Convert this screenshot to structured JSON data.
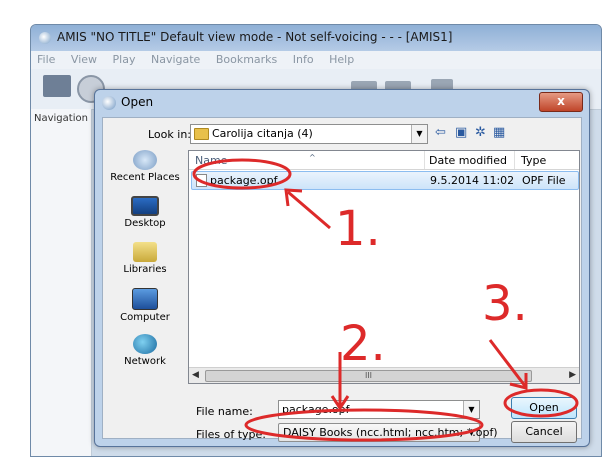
{
  "app": {
    "title": "AMIS \"NO TITLE\" Default view mode - Not self-voicing - - - [AMIS1]",
    "menu": [
      "File",
      "View",
      "Play",
      "Navigate",
      "Bookmarks",
      "Info",
      "Help"
    ],
    "nav_label": "Navigation"
  },
  "dialog": {
    "title": "Open",
    "close_label": "x",
    "look_in_label": "Look in:",
    "look_in_value": "Carolija citanja (4)",
    "places": [
      "Recent Places",
      "Desktop",
      "Libraries",
      "Computer",
      "Network"
    ],
    "columns": [
      "Name",
      "Date modified",
      "Type"
    ],
    "files": [
      {
        "name": "package.opf",
        "date": "9.5.2014 11:02",
        "type": "OPF File"
      }
    ],
    "scroll_grip": "III",
    "file_name_label": "File name:",
    "file_name_value": "package.opf",
    "files_of_type_label": "Files of type:",
    "files_of_type_value": "DAISY Books (ncc.html; ncc.htm; *.opf)",
    "open_button": "Open",
    "cancel_button": "Cancel"
  },
  "annotations": {
    "steps": [
      "1.",
      "2.",
      "3."
    ],
    "color": "#dd2a2a"
  },
  "icons": {
    "nav": [
      "back-arrow-icon",
      "up-folder-icon",
      "new-folder-icon",
      "view-menu-icon"
    ]
  }
}
